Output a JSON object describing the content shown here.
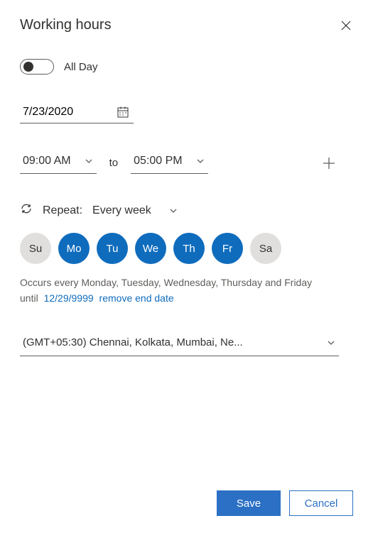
{
  "header": {
    "title": "Working hours"
  },
  "allDay": {
    "label": "All Day",
    "checked": false
  },
  "date": {
    "value": "7/23/2020"
  },
  "time": {
    "start": "09:00 AM",
    "to_label": "to",
    "end": "05:00 PM"
  },
  "repeat": {
    "label": "Repeat:",
    "value": "Every week",
    "days": [
      {
        "abbr": "Su",
        "on": false
      },
      {
        "abbr": "Mo",
        "on": true
      },
      {
        "abbr": "Tu",
        "on": true
      },
      {
        "abbr": "We",
        "on": true
      },
      {
        "abbr": "Th",
        "on": true
      },
      {
        "abbr": "Fr",
        "on": true
      },
      {
        "abbr": "Sa",
        "on": false
      }
    ],
    "description": "Occurs every Monday, Tuesday, Wednesday, Thursday and Friday",
    "until_label": "until",
    "until_date": "12/29/9999",
    "remove_label": "remove end date"
  },
  "timezone": {
    "value": "(GMT+05:30) Chennai, Kolkata, Mumbai, Ne..."
  },
  "footer": {
    "save": "Save",
    "cancel": "Cancel"
  }
}
